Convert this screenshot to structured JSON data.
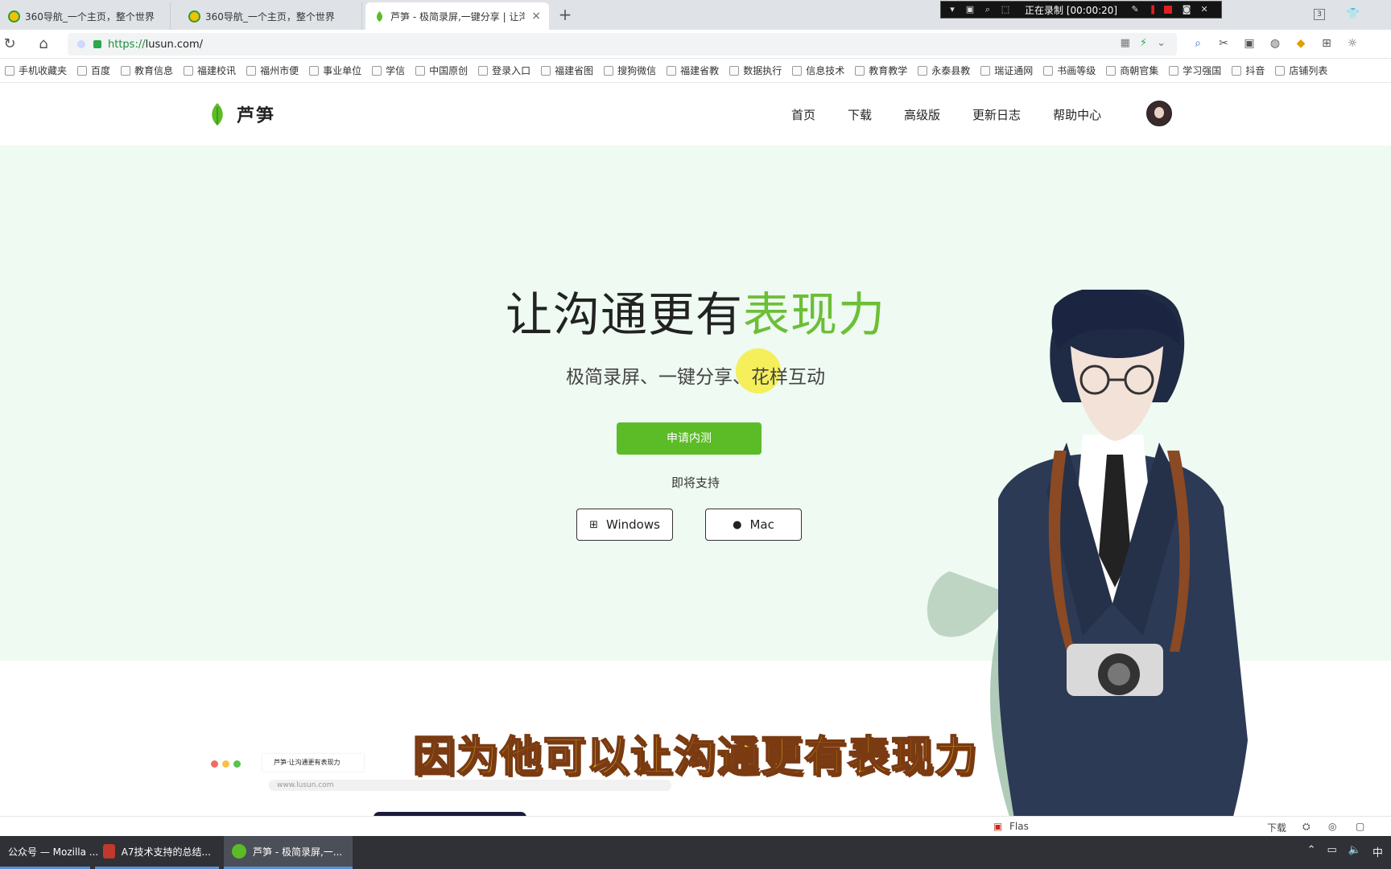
{
  "browser": {
    "tabs": [
      {
        "title": "360导航_一个主页，整个世界",
        "active": false
      },
      {
        "title": "360导航_一个主页，整个世界",
        "active": false
      },
      {
        "title": "芦笋 - 极简录屏,一键分享 | 让沟",
        "active": true
      }
    ],
    "new_tab": "+",
    "tab_close": "×",
    "tab_count": "3",
    "address": {
      "scheme": "https://",
      "host": "lusun.com/"
    },
    "bookmarks": [
      "手机收藏夹",
      "百度",
      "教育信息",
      "福建校讯",
      "福州市便",
      "事业单位",
      "学信",
      "中国原创",
      "登录入口",
      "福建省图",
      "搜狗微信",
      "福建省教",
      "数据执行",
      "信息技术",
      "教育教学",
      "永泰县教",
      "瑞证通网",
      "书画等级",
      "商朝官集",
      "学习强国",
      "抖音",
      "店铺列表"
    ]
  },
  "recorder": {
    "status": "正在录制 [00:00:20]",
    "close": "✕"
  },
  "site": {
    "logo_text": "芦笋",
    "nav": [
      "首页",
      "下载",
      "高级版",
      "更新日志",
      "帮助中心"
    ],
    "hero": {
      "title_plain": "让沟通更有",
      "title_highlight": "表现力",
      "subtitle": "极简录屏、一键分享、花样互动",
      "cta": "申请内测",
      "soon": "即将支持",
      "windows": "Windows",
      "mac": "Mac"
    },
    "preview": {
      "tab": "芦笋·让沟通更有表现力",
      "url": "www.lusun.com"
    }
  },
  "caption": "因为他可以让沟通更有表现力",
  "status_strip": {
    "left": "Flas",
    "right": "下载"
  },
  "taskbar": {
    "tasks": [
      "公众号 — Mozilla ...",
      "A7技术支持的总结...",
      "芦笋 - 极简录屏,一..."
    ],
    "ime": "中"
  },
  "colors": {
    "brand_green": "#5cbc27",
    "hero_bg": "#eefaf2",
    "caption_fill": "#f5c518",
    "caption_stroke": "#7a3a12"
  }
}
